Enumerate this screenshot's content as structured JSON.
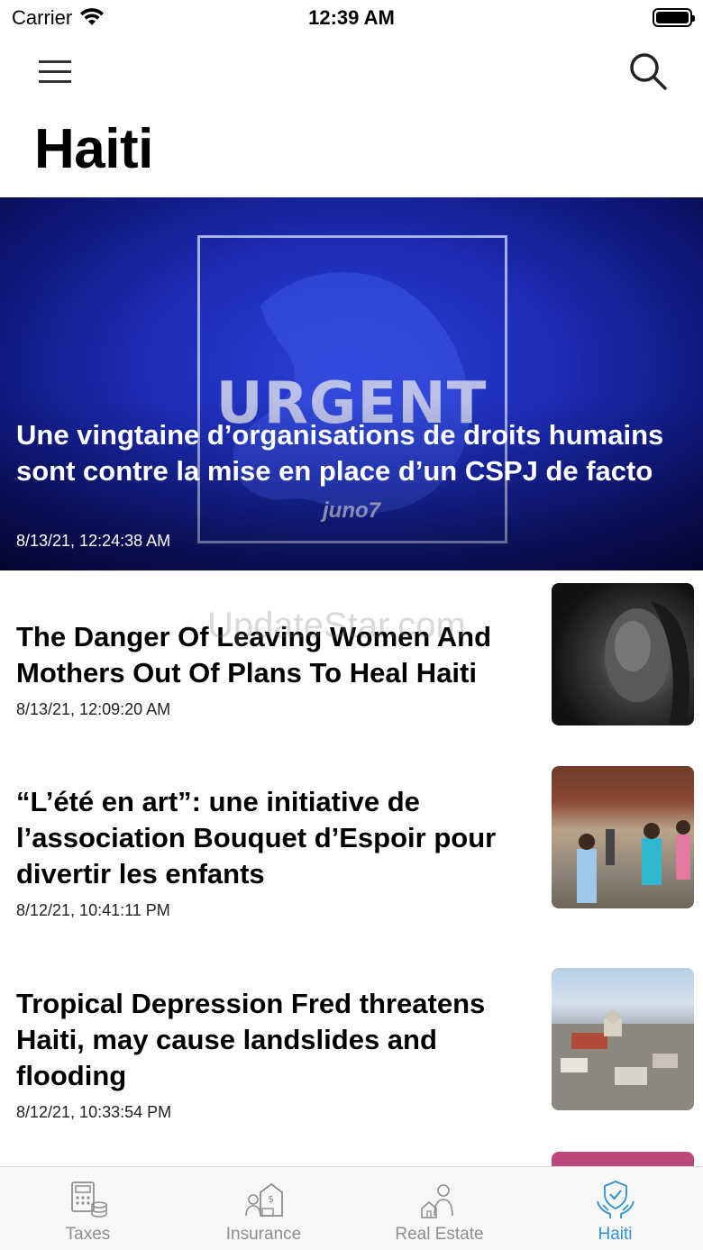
{
  "status_bar": {
    "carrier": "Carrier",
    "time": "12:39 AM"
  },
  "header": {
    "title": "Haiti"
  },
  "hero": {
    "image_text": "URGENT",
    "image_logo": "juno7",
    "title": "Une vingtaine d’organisations de droits humains sont contre la mise en place d’un CSPJ de facto",
    "date": "8/13/21, 12:24:38 AM"
  },
  "articles": [
    {
      "title": "The Danger Of Leaving Women And Mothers Out Of Plans To Heal Haiti",
      "date": "8/13/21, 12:09:20 AM"
    },
    {
      "title": "“L’été en art”: une initiative de l’association Bouquet d’Espoir pour divertir les enfants",
      "date": "8/12/21, 10:41:11 PM"
    },
    {
      "title": "Tropical Depression Fred threatens Haiti, may cause landslides and flooding",
      "date": "8/12/21, 10:33:54 PM"
    }
  ],
  "watermark": "UpdateStar.com",
  "tabs": [
    {
      "label": "Taxes",
      "icon": "calculator-coins-icon",
      "active": false
    },
    {
      "label": "Insurance",
      "icon": "insurance-agent-icon",
      "active": false
    },
    {
      "label": "Real Estate",
      "icon": "real-estate-agent-icon",
      "active": false
    },
    {
      "label": "Haiti",
      "icon": "shield-hands-icon",
      "active": true
    }
  ],
  "colors": {
    "accent": "#2f8fd6",
    "hero_bg": "#1d2db8",
    "tab_inactive": "#8e8e8e"
  }
}
